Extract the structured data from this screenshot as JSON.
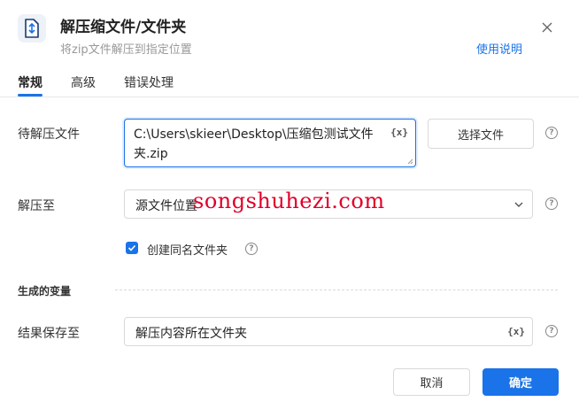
{
  "dialog": {
    "title": "解压缩文件/文件夹",
    "subtitle": "将zip文件解压到指定位置",
    "help_link": "使用说明",
    "icon": "unzip-file-icon"
  },
  "tabs": [
    {
      "label": "常规",
      "active": true
    },
    {
      "label": "高级",
      "active": false
    },
    {
      "label": "错误处理",
      "active": false
    }
  ],
  "fields": {
    "source_file": {
      "label": "待解压文件",
      "value": "C:\\Users\\skieer\\Desktop\\压缩包测试文件夹.zip",
      "var_icon": "{x}",
      "button_label": "选择文件"
    },
    "extract_to": {
      "label": "解压至",
      "selected": "源文件位置"
    },
    "create_folder": {
      "label": "创建同名文件夹",
      "checked": true
    }
  },
  "output_section": {
    "title": "生成的变量",
    "result": {
      "label": "结果保存至",
      "value": "解压内容所在文件夹",
      "var_icon": "{x}"
    }
  },
  "footer": {
    "cancel_label": "取消",
    "ok_label": "确定"
  },
  "watermark": "songshuhezi.com",
  "colors": {
    "accent": "#1a73e8",
    "watermark": "#e0002a"
  }
}
